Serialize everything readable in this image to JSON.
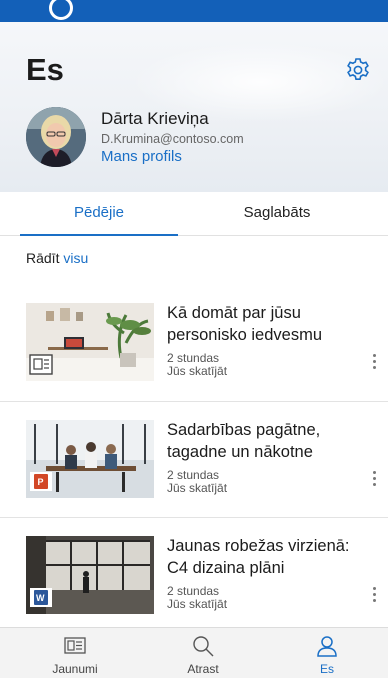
{
  "header": {
    "title": "Es",
    "settings_icon": "gear-icon"
  },
  "user": {
    "name": "Dārta Krieviņa",
    "email": "D.Krumina@contoso.com",
    "profile_link": "Mans profils"
  },
  "tabs": [
    {
      "label": "Pēdējie",
      "active": true
    },
    {
      "label": "Saglabāts",
      "active": false
    }
  ],
  "filter": {
    "prefix": "Rādīt",
    "link": "visu"
  },
  "items": [
    {
      "title": "Kā domāt par jūsu personisko iedvesmu",
      "time": "2 stundas",
      "status": "Jūs skatījāt",
      "badge": "news-icon"
    },
    {
      "title": "Sadarbības pagātne, tagadne un nākotne",
      "time": "2 stundas",
      "status": "Jūs skatījāt",
      "badge": "powerpoint-icon"
    },
    {
      "title": "Jaunas robežas virzienā: C4 dizaina plāni",
      "time": "2 stundas",
      "status": "Jūs skatījāt",
      "badge": "word-icon"
    }
  ],
  "bottom_nav": [
    {
      "label": "Jaunumi",
      "icon": "news-icon",
      "active": false
    },
    {
      "label": "Atrast",
      "icon": "search-icon",
      "active": false
    },
    {
      "label": "Es",
      "icon": "person-icon",
      "active": true
    }
  ],
  "colors": {
    "accent": "#1a6fc6",
    "topbar": "#1360b8"
  }
}
